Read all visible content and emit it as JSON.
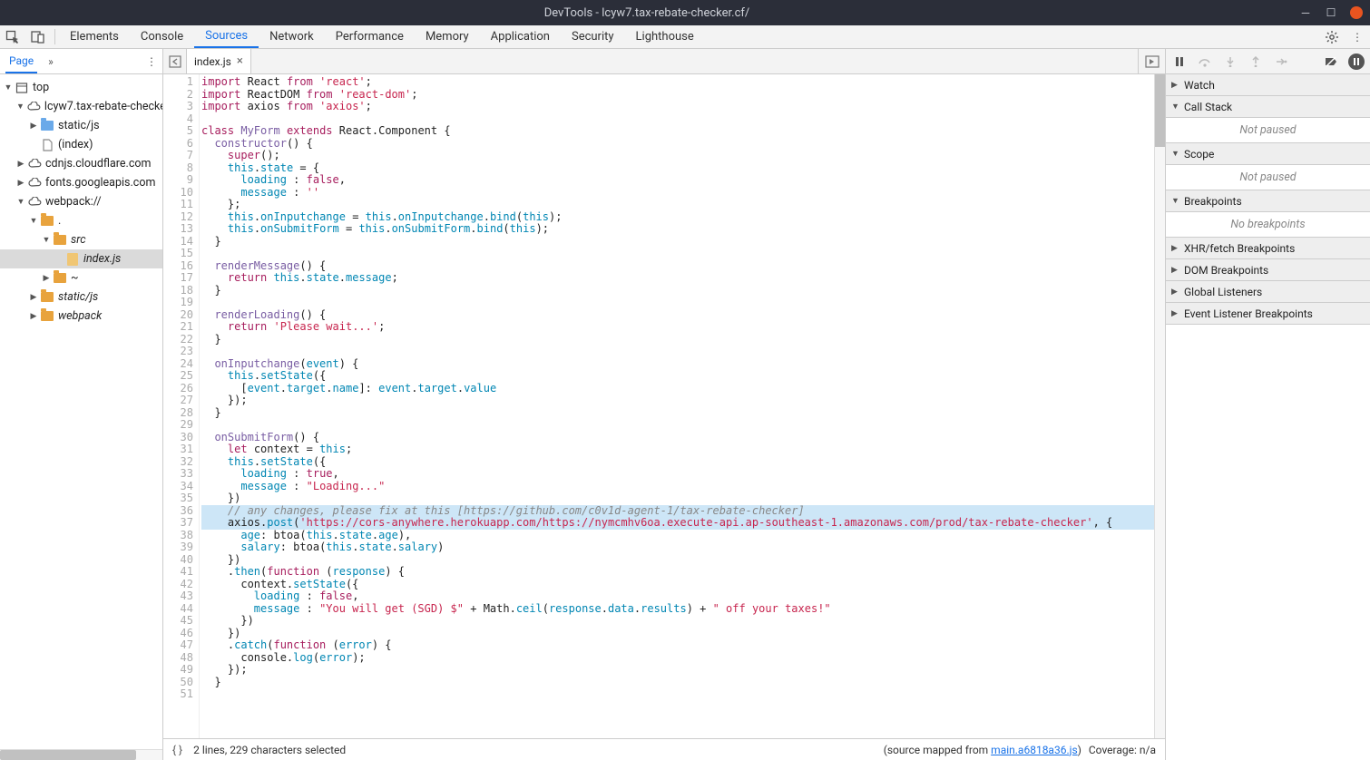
{
  "window": {
    "title": "DevTools - lcyw7.tax-rebate-checker.cf/"
  },
  "toolbar": {
    "tabs": [
      "Elements",
      "Console",
      "Sources",
      "Network",
      "Performance",
      "Memory",
      "Application",
      "Security",
      "Lighthouse"
    ],
    "active": 2
  },
  "left": {
    "tab": "Page",
    "tree": [
      {
        "depth": 0,
        "arrow": "down",
        "icon": "frame",
        "label": "top"
      },
      {
        "depth": 1,
        "arrow": "down",
        "icon": "cloud",
        "label": "lcyw7.tax-rebate-checker.cf"
      },
      {
        "depth": 2,
        "arrow": "right",
        "icon": "folder-blue",
        "label": "static/js"
      },
      {
        "depth": 2,
        "arrow": "",
        "icon": "doc",
        "label": "(index)"
      },
      {
        "depth": 1,
        "arrow": "right",
        "icon": "cloud",
        "label": "cdnjs.cloudflare.com"
      },
      {
        "depth": 1,
        "arrow": "right",
        "icon": "cloud",
        "label": "fonts.googleapis.com"
      },
      {
        "depth": 1,
        "arrow": "down",
        "icon": "cloud",
        "label": "webpack://"
      },
      {
        "depth": 2,
        "arrow": "down",
        "icon": "folder-yellow",
        "label": "."
      },
      {
        "depth": 3,
        "arrow": "down",
        "icon": "folder-yellow",
        "label": "src",
        "italic": true
      },
      {
        "depth": 4,
        "arrow": "",
        "icon": "file-yellow",
        "label": "index.js",
        "italic": true,
        "selected": true
      },
      {
        "depth": 3,
        "arrow": "right",
        "icon": "folder-yellow",
        "label": "~"
      },
      {
        "depth": 2,
        "arrow": "right",
        "icon": "folder-yellow",
        "label": "static/js",
        "italic": true
      },
      {
        "depth": 2,
        "arrow": "right",
        "icon": "folder-yellow",
        "label": "webpack",
        "italic": true
      }
    ]
  },
  "file_tabs": {
    "current": "index.js"
  },
  "status": {
    "selection": "2 lines, 229 characters selected",
    "mapped_prefix": "(source mapped from ",
    "mapped_link": "main.a6818a36.js",
    "mapped_suffix": ")",
    "coverage": "Coverage: n/a"
  },
  "debug": {
    "sections": [
      {
        "name": "Watch",
        "open": false
      },
      {
        "name": "Call Stack",
        "open": true,
        "body": "Not paused"
      },
      {
        "name": "Scope",
        "open": true,
        "body": "Not paused"
      },
      {
        "name": "Breakpoints",
        "open": true,
        "body": "No breakpoints"
      },
      {
        "name": "XHR/fetch Breakpoints",
        "open": false
      },
      {
        "name": "DOM Breakpoints",
        "open": false
      },
      {
        "name": "Global Listeners",
        "open": false
      },
      {
        "name": "Event Listener Breakpoints",
        "open": false
      }
    ]
  },
  "code": {
    "highlighted_lines": [
      36,
      37
    ],
    "lines": [
      [
        [
          "kw",
          "import"
        ],
        [
          "",
          " React "
        ],
        [
          "kw",
          "from"
        ],
        [
          "",
          " "
        ],
        [
          "str",
          "'react'"
        ],
        [
          "",
          ";"
        ]
      ],
      [
        [
          "kw",
          "import"
        ],
        [
          "",
          " ReactDOM "
        ],
        [
          "kw",
          "from"
        ],
        [
          "",
          " "
        ],
        [
          "str",
          "'react-dom'"
        ],
        [
          "",
          ";"
        ]
      ],
      [
        [
          "kw",
          "import"
        ],
        [
          "",
          " axios "
        ],
        [
          "kw",
          "from"
        ],
        [
          "",
          " "
        ],
        [
          "str",
          "'axios'"
        ],
        [
          "",
          ";"
        ]
      ],
      [],
      [
        [
          "kw",
          "class"
        ],
        [
          "",
          " "
        ],
        [
          "def",
          "MyForm"
        ],
        [
          "",
          " "
        ],
        [
          "kw",
          "extends"
        ],
        [
          "",
          " React.Component {"
        ]
      ],
      [
        [
          "",
          "  "
        ],
        [
          "def",
          "constructor"
        ],
        [
          "",
          "() {"
        ]
      ],
      [
        [
          "",
          "    "
        ],
        [
          "kw",
          "super"
        ],
        [
          "",
          "();"
        ]
      ],
      [
        [
          "",
          "    "
        ],
        [
          "this",
          "this"
        ],
        [
          "",
          "."
        ],
        [
          "prop",
          "state"
        ],
        [
          "",
          " = {"
        ]
      ],
      [
        [
          "",
          "      "
        ],
        [
          "prop",
          "loading"
        ],
        [
          "",
          " : "
        ],
        [
          "kw",
          "false"
        ],
        [
          "",
          ","
        ]
      ],
      [
        [
          "",
          "      "
        ],
        [
          "prop",
          "message"
        ],
        [
          "",
          " : "
        ],
        [
          "str",
          "''"
        ]
      ],
      [
        [
          "",
          "    };"
        ]
      ],
      [
        [
          "",
          "    "
        ],
        [
          "this",
          "this"
        ],
        [
          "",
          "."
        ],
        [
          "prop",
          "onInputchange"
        ],
        [
          "",
          " = "
        ],
        [
          "this",
          "this"
        ],
        [
          "",
          "."
        ],
        [
          "prop",
          "onInputchange"
        ],
        [
          "",
          "."
        ],
        [
          "prop",
          "bind"
        ],
        [
          "",
          "("
        ],
        [
          "this",
          "this"
        ],
        [
          "",
          ");"
        ]
      ],
      [
        [
          "",
          "    "
        ],
        [
          "this",
          "this"
        ],
        [
          "",
          "."
        ],
        [
          "prop",
          "onSubmitForm"
        ],
        [
          "",
          " = "
        ],
        [
          "this",
          "this"
        ],
        [
          "",
          "."
        ],
        [
          "prop",
          "onSubmitForm"
        ],
        [
          "",
          "."
        ],
        [
          "prop",
          "bind"
        ],
        [
          "",
          "("
        ],
        [
          "this",
          "this"
        ],
        [
          "",
          ");"
        ]
      ],
      [
        [
          "",
          "  }"
        ]
      ],
      [],
      [
        [
          "",
          "  "
        ],
        [
          "def",
          "renderMessage"
        ],
        [
          "",
          "() {"
        ]
      ],
      [
        [
          "",
          "    "
        ],
        [
          "kw",
          "return"
        ],
        [
          "",
          " "
        ],
        [
          "this",
          "this"
        ],
        [
          "",
          "."
        ],
        [
          "prop",
          "state"
        ],
        [
          "",
          "."
        ],
        [
          "prop",
          "message"
        ],
        [
          "",
          ";"
        ]
      ],
      [
        [
          "",
          "  }"
        ]
      ],
      [],
      [
        [
          "",
          "  "
        ],
        [
          "def",
          "renderLoading"
        ],
        [
          "",
          "() {"
        ]
      ],
      [
        [
          "",
          "    "
        ],
        [
          "kw",
          "return"
        ],
        [
          "",
          " "
        ],
        [
          "str",
          "'Please wait...'"
        ],
        [
          "",
          ";"
        ]
      ],
      [
        [
          "",
          "  }"
        ]
      ],
      [],
      [
        [
          "",
          "  "
        ],
        [
          "def",
          "onInputchange"
        ],
        [
          "",
          "("
        ],
        [
          "prop",
          "event"
        ],
        [
          "",
          ") {"
        ]
      ],
      [
        [
          "",
          "    "
        ],
        [
          "this",
          "this"
        ],
        [
          "",
          "."
        ],
        [
          "prop",
          "setState"
        ],
        [
          "",
          "({"
        ]
      ],
      [
        [
          "",
          "      ["
        ],
        [
          "prop",
          "event"
        ],
        [
          "",
          "."
        ],
        [
          "prop",
          "target"
        ],
        [
          "",
          "."
        ],
        [
          "prop",
          "name"
        ],
        [
          "",
          "]: "
        ],
        [
          "prop",
          "event"
        ],
        [
          "",
          "."
        ],
        [
          "prop",
          "target"
        ],
        [
          "",
          "."
        ],
        [
          "prop",
          "value"
        ]
      ],
      [
        [
          "",
          "    });"
        ]
      ],
      [
        [
          "",
          "  }"
        ]
      ],
      [],
      [
        [
          "",
          "  "
        ],
        [
          "def",
          "onSubmitForm"
        ],
        [
          "",
          "() {"
        ]
      ],
      [
        [
          "",
          "    "
        ],
        [
          "kw",
          "let"
        ],
        [
          "",
          " context = "
        ],
        [
          "this",
          "this"
        ],
        [
          "",
          ";"
        ]
      ],
      [
        [
          "",
          "    "
        ],
        [
          "this",
          "this"
        ],
        [
          "",
          "."
        ],
        [
          "prop",
          "setState"
        ],
        [
          "",
          "({"
        ]
      ],
      [
        [
          "",
          "      "
        ],
        [
          "prop",
          "loading"
        ],
        [
          "",
          " : "
        ],
        [
          "kw",
          "true"
        ],
        [
          "",
          ","
        ]
      ],
      [
        [
          "",
          "      "
        ],
        [
          "prop",
          "message"
        ],
        [
          "",
          " : "
        ],
        [
          "str",
          "\"Loading...\""
        ]
      ],
      [
        [
          "",
          "    })"
        ]
      ],
      [
        [
          "com",
          "    // any changes, please fix at this [https://github.com/c0v1d-agent-1/tax-rebate-checker]"
        ]
      ],
      [
        [
          "",
          "    axios."
        ],
        [
          "prop",
          "post"
        ],
        [
          "",
          "("
        ],
        [
          "str",
          "'https://cors-anywhere.herokuapp.com/https://nymcmhv6oa.execute-api.ap-southeast-1.amazonaws.com/prod/tax-rebate-checker'"
        ],
        [
          "",
          ", {"
        ]
      ],
      [
        [
          "",
          "      "
        ],
        [
          "prop",
          "age"
        ],
        [
          "",
          ": btoa("
        ],
        [
          "this",
          "this"
        ],
        [
          "",
          "."
        ],
        [
          "prop",
          "state"
        ],
        [
          "",
          "."
        ],
        [
          "prop",
          "age"
        ],
        [
          "",
          "),"
        ]
      ],
      [
        [
          "",
          "      "
        ],
        [
          "prop",
          "salary"
        ],
        [
          "",
          ": btoa("
        ],
        [
          "this",
          "this"
        ],
        [
          "",
          "."
        ],
        [
          "prop",
          "state"
        ],
        [
          "",
          "."
        ],
        [
          "prop",
          "salary"
        ],
        [
          "",
          ")"
        ]
      ],
      [
        [
          "",
          "    })"
        ]
      ],
      [
        [
          "",
          "    ."
        ],
        [
          "prop",
          "then"
        ],
        [
          "",
          "("
        ],
        [
          "kw",
          "function"
        ],
        [
          "",
          " ("
        ],
        [
          "prop",
          "response"
        ],
        [
          "",
          ") {"
        ]
      ],
      [
        [
          "",
          "      context."
        ],
        [
          "prop",
          "setState"
        ],
        [
          "",
          "({"
        ]
      ],
      [
        [
          "",
          "        "
        ],
        [
          "prop",
          "loading"
        ],
        [
          "",
          " : "
        ],
        [
          "kw",
          "false"
        ],
        [
          "",
          ","
        ]
      ],
      [
        [
          "",
          "        "
        ],
        [
          "prop",
          "message"
        ],
        [
          "",
          " : "
        ],
        [
          "str",
          "\"You will get (SGD) $\""
        ],
        [
          "",
          " + Math."
        ],
        [
          "prop",
          "ceil"
        ],
        [
          "",
          "("
        ],
        [
          "prop",
          "response"
        ],
        [
          "",
          "."
        ],
        [
          "prop",
          "data"
        ],
        [
          "",
          "."
        ],
        [
          "prop",
          "results"
        ],
        [
          "",
          ") + "
        ],
        [
          "str",
          "\" off your taxes!\""
        ]
      ],
      [
        [
          "",
          "      })"
        ]
      ],
      [
        [
          "",
          "    })"
        ]
      ],
      [
        [
          "",
          "    ."
        ],
        [
          "prop",
          "catch"
        ],
        [
          "",
          "("
        ],
        [
          "kw",
          "function"
        ],
        [
          "",
          " ("
        ],
        [
          "prop",
          "error"
        ],
        [
          "",
          ") {"
        ]
      ],
      [
        [
          "",
          "      console."
        ],
        [
          "prop",
          "log"
        ],
        [
          "",
          "("
        ],
        [
          "prop",
          "error"
        ],
        [
          "",
          ");"
        ]
      ],
      [
        [
          "",
          "    });"
        ]
      ],
      [
        [
          "",
          "  }"
        ]
      ],
      []
    ]
  }
}
